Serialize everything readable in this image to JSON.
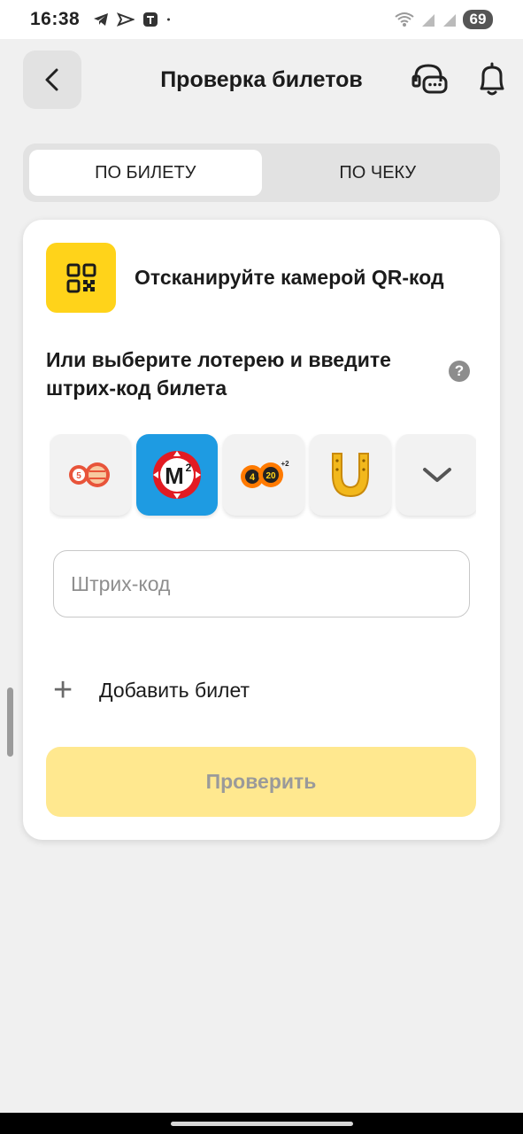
{
  "status_bar": {
    "time": "16:38",
    "battery": "69"
  },
  "header": {
    "title": "Проверка билетов"
  },
  "tabs": [
    {
      "label": "ПО БИЛЕТУ",
      "active": true
    },
    {
      "label": "ПО ЧЕКУ",
      "active": false
    }
  ],
  "card": {
    "qr_text": "Отсканируйте камерой QR-код",
    "choose_text": "Или выберите лотерею и введите штрих-код билета",
    "help_symbol": "?",
    "lotteries": [
      {
        "name": "lottery-5-balls-icon",
        "selected": false
      },
      {
        "name": "lottery-m2-icon",
        "selected": true
      },
      {
        "name": "lottery-4-20-icon",
        "selected": false
      },
      {
        "name": "lottery-horseshoe-icon",
        "selected": false
      },
      {
        "name": "chevron-down-icon",
        "selected": false
      }
    ],
    "barcode_placeholder": "Штрих-код",
    "add_ticket_symbol": "+",
    "add_ticket_label": "Добавить билет",
    "check_button": "Проверить"
  },
  "colors": {
    "accent": "#ffd31a",
    "selected_lottery": "#1e9be2",
    "check_button_disabled": "#ffe88f"
  }
}
